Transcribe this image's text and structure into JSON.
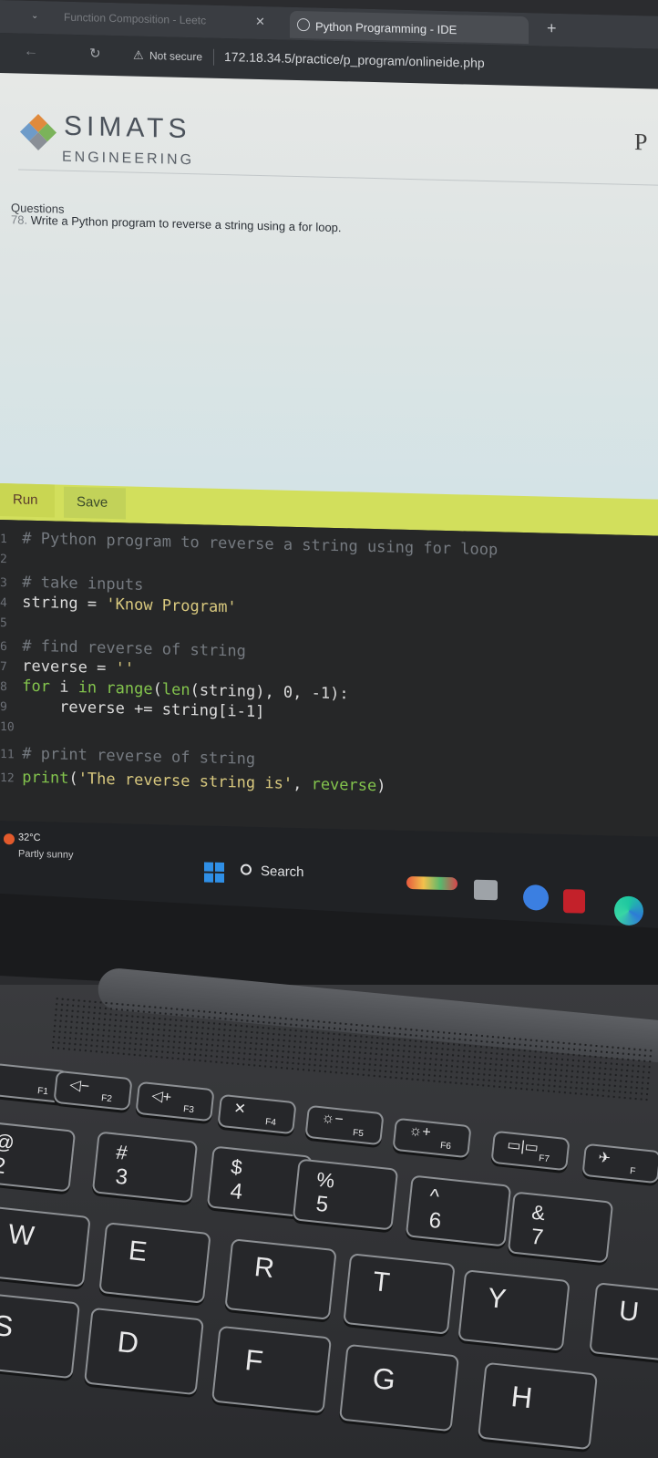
{
  "browser": {
    "tabs": [
      {
        "title": "Function Composition - Leetc",
        "close": "✕"
      },
      {
        "title": "Python Programming - IDE",
        "close": "✕"
      }
    ],
    "new_tab": "+",
    "tab_menu": "⌄",
    "back": "←",
    "reload": "↻",
    "security_icon": "⚠",
    "security": "Not secure",
    "url": "172.18.34.5/practice/p_program/onlineide.php"
  },
  "site": {
    "brand_top": "SIMATS",
    "brand_bottom": "ENGINEERING",
    "right_fragment": "P",
    "questions_heading": "Questions",
    "question_number": "78.",
    "question_text": "Write a Python program to reverse a string using a for loop."
  },
  "toolbar": {
    "run": "Run",
    "save": "Save"
  },
  "editor": {
    "lines": [
      {
        "n": "1",
        "html": "<span class='cm'># Python program to reverse a string using for loop</span>"
      },
      {
        "n": "2",
        "html": ""
      },
      {
        "n": "3",
        "html": "<span class='cm'># take inputs</span>"
      },
      {
        "n": "4",
        "html": "<span class='tx'>string = </span><span class='st'>'Know Program'</span>"
      },
      {
        "n": "5",
        "html": ""
      },
      {
        "n": "6",
        "html": "<span class='cm'># find reverse of string</span>"
      },
      {
        "n": "7",
        "html": "<span class='tx'>reverse = </span><span class='st'>''</span>"
      },
      {
        "n": "8",
        "html": "<span class='kw'>for</span><span class='tx'> i </span><span class='kw'>in</span><span class='tx'> </span><span class='kw'>range</span><span class='tx'>(</span><span class='kw'>len</span><span class='tx'>(string), 0, -1):</span>"
      },
      {
        "n": "9",
        "html": "<span class='tx'>    reverse += string[i-1]</span>"
      },
      {
        "n": "10",
        "html": ""
      },
      {
        "n": "11",
        "html": "<span class='cm'># print reverse of string</span>"
      },
      {
        "n": "12",
        "html": "<span class='kw'>print</span><span class='tx'>(</span><span class='st'>'The reverse string is'</span><span class='tx'>, </span><span class='kw'>reverse</span><span class='tx'>)</span>"
      }
    ]
  },
  "taskbar": {
    "temperature": "32°C",
    "condition": "Partly sunny",
    "search": "Search"
  },
  "keyboard": {
    "function_keys": [
      {
        "id": "f1",
        "glyph": "",
        "label": "F1"
      },
      {
        "id": "f2",
        "glyph": "◁−",
        "label": "F2"
      },
      {
        "id": "f3",
        "glyph": "◁+",
        "label": "F3"
      },
      {
        "id": "f4",
        "glyph": "✕",
        "label": "F4"
      },
      {
        "id": "f5",
        "glyph": "☼−",
        "label": "F5"
      },
      {
        "id": "f6",
        "glyph": "☼+",
        "label": "F6"
      },
      {
        "id": "f7",
        "glyph": "▭|▭",
        "label": "F7"
      },
      {
        "id": "f8",
        "glyph": "✈",
        "label": "F"
      }
    ],
    "number_keys": [
      {
        "id": "2",
        "upper": "@",
        "lower": "2"
      },
      {
        "id": "3",
        "upper": "#",
        "lower": "3"
      },
      {
        "id": "4",
        "upper": "$",
        "lower": "4"
      },
      {
        "id": "5",
        "upper": "%",
        "lower": "5"
      },
      {
        "id": "6",
        "upper": "^",
        "lower": "6"
      },
      {
        "id": "7",
        "upper": "&",
        "lower": "7"
      }
    ],
    "letter_row_top": [
      "W",
      "E",
      "R",
      "T",
      "Y",
      "U"
    ],
    "letter_row_mid": [
      "S",
      "D",
      "F",
      "G",
      "H"
    ]
  }
}
